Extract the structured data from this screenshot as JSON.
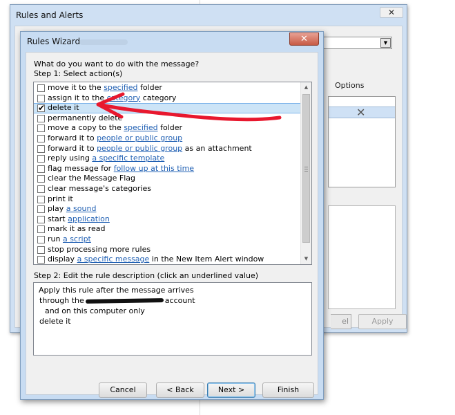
{
  "background_window": {
    "title": "Rules and Alerts",
    "close_glyph": "✕",
    "tab_options": "Options",
    "list_delete_glyph": "✕",
    "button_partial": "el",
    "apply_button": "Apply"
  },
  "wizard": {
    "title": "Rules Wizard",
    "close_glyph": "✕",
    "question": "What do you want to do with the message?",
    "step1_label": "Step 1: Select action(s)",
    "step2_label": "Step 2: Edit the rule description (click an underlined value)",
    "actions": [
      {
        "checked": false,
        "pre": "move it to the ",
        "link": "specified",
        "post": " folder"
      },
      {
        "checked": false,
        "pre": "assign it to the ",
        "link": "category",
        "post": " category"
      },
      {
        "checked": true,
        "pre": "delete it",
        "link": "",
        "post": ""
      },
      {
        "checked": false,
        "pre": "permanently delete",
        "link": "",
        "post": ""
      },
      {
        "checked": false,
        "pre": "move a copy to the ",
        "link": "specified",
        "post": " folder"
      },
      {
        "checked": false,
        "pre": "forward it to ",
        "link": "people or public group",
        "post": ""
      },
      {
        "checked": false,
        "pre": "forward it to ",
        "link": "people or public group",
        "post": " as an attachment"
      },
      {
        "checked": false,
        "pre": "reply using ",
        "link": "a specific template",
        "post": ""
      },
      {
        "checked": false,
        "pre": "flag message for ",
        "link": "follow up at this time",
        "post": ""
      },
      {
        "checked": false,
        "pre": "clear the Message Flag",
        "link": "",
        "post": ""
      },
      {
        "checked": false,
        "pre": "clear message's categories",
        "link": "",
        "post": ""
      },
      {
        "checked": false,
        "pre": "print it",
        "link": "",
        "post": ""
      },
      {
        "checked": false,
        "pre": "play ",
        "link": "a sound",
        "post": ""
      },
      {
        "checked": false,
        "pre": "start ",
        "link": "application",
        "post": ""
      },
      {
        "checked": false,
        "pre": "mark it as read",
        "link": "",
        "post": ""
      },
      {
        "checked": false,
        "pre": "run ",
        "link": "a script",
        "post": ""
      },
      {
        "checked": false,
        "pre": "stop processing more rules",
        "link": "",
        "post": ""
      },
      {
        "checked": false,
        "pre": "display ",
        "link": "a specific message",
        "post": " in the New Item Alert window"
      }
    ],
    "description": {
      "line1": "Apply this rule after the message arrives",
      "line2_pre": "through the",
      "line2_post": "account",
      "line3": "and on this computer only",
      "line4": "delete it"
    },
    "buttons": {
      "cancel": "Cancel",
      "back": "< Back",
      "next": "Next >",
      "finish": "Finish"
    },
    "check_glyph": "✔",
    "scroll_up_glyph": "▲",
    "scroll_down_glyph": "▼",
    "combo_glyph": "▼"
  },
  "colors": {
    "annotation_arrow": "#e8182e",
    "link": "#1f5fb3",
    "selection": "#cce4f7"
  }
}
